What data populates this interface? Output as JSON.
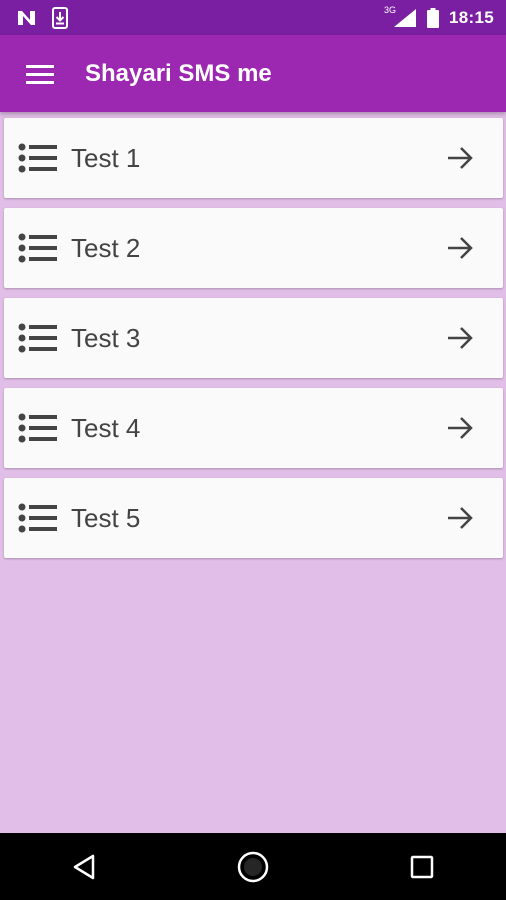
{
  "status_bar": {
    "time": "18:15",
    "network": "3G",
    "icons": [
      "n-notification-icon",
      "download-notification-icon",
      "signal-icon",
      "battery-icon"
    ]
  },
  "app_bar": {
    "title": "Shayari SMS me",
    "menu_icon": "hamburger-menu-icon"
  },
  "items": [
    {
      "label": "Test 1"
    },
    {
      "label": "Test 2"
    },
    {
      "label": "Test 3"
    },
    {
      "label": "Test 4"
    },
    {
      "label": "Test 5"
    }
  ],
  "nav_bar": {
    "buttons": [
      "back-icon",
      "home-icon",
      "recents-icon"
    ]
  },
  "colors": {
    "status_bar": "#7b1fa2",
    "app_bar": "#9c27b0",
    "background": "#e1bee7",
    "card": "#fafafa",
    "text": "#444444"
  }
}
